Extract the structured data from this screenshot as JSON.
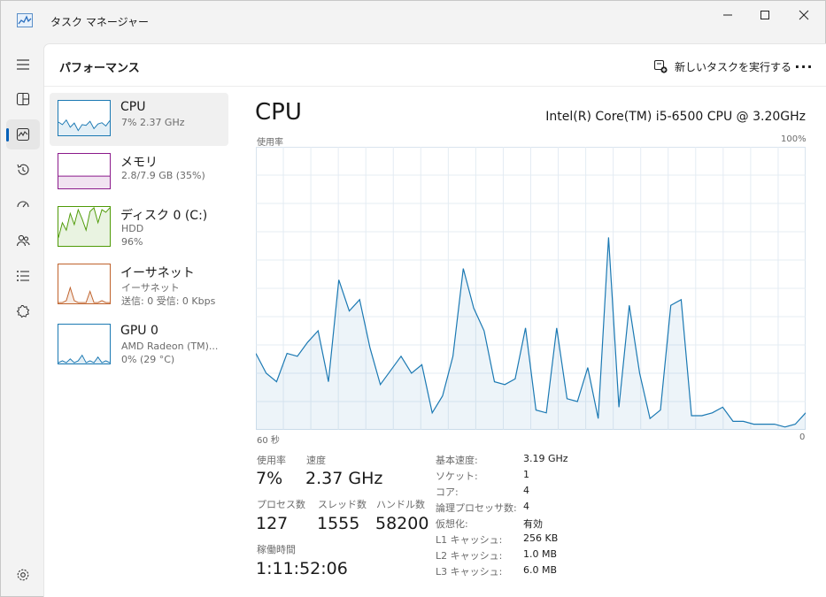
{
  "window": {
    "title": "タスク マネージャー"
  },
  "nav": {
    "items": [
      {
        "icon": "hamburger-menu-icon"
      },
      {
        "icon": "processes-icon"
      },
      {
        "icon": "performance-icon",
        "active": true
      },
      {
        "icon": "app-history-icon"
      },
      {
        "icon": "startup-apps-icon"
      },
      {
        "icon": "users-icon"
      },
      {
        "icon": "details-icon"
      },
      {
        "icon": "services-icon"
      },
      {
        "icon": "settings-icon"
      }
    ]
  },
  "header": {
    "page_title": "パフォーマンス",
    "new_task_label": "新しいタスクを実行する",
    "more_label": "···"
  },
  "devices": [
    {
      "name": "CPU",
      "sub1": "7%  2.37 GHz",
      "sub2": "",
      "sub3": "",
      "color": "#1b79b3",
      "spark": [
        38,
        30,
        44,
        22,
        35,
        12,
        30,
        28,
        40,
        18,
        32,
        36,
        26,
        42
      ]
    },
    {
      "name": "メモリ",
      "sub1": "2.8/7.9 GB (35%)",
      "sub2": "",
      "sub3": "",
      "color": "#8b1a8b",
      "spark": [
        35,
        35,
        35,
        35,
        35,
        35,
        35,
        35,
        35,
        35,
        35,
        35,
        35,
        35
      ]
    },
    {
      "name": "ディスク 0 (C:)",
      "sub1": "HDD",
      "sub2": "96%",
      "sub3": "",
      "color": "#4e9a06",
      "spark": [
        20,
        60,
        40,
        85,
        55,
        95,
        70,
        40,
        90,
        100,
        60,
        95,
        88,
        100
      ]
    },
    {
      "name": "イーサネット",
      "sub1": "イーサネット",
      "sub2": "送信: 0 受信: 0 Kbps",
      "sub3": "",
      "color": "#c0622b",
      "spark": [
        0,
        0,
        5,
        40,
        5,
        0,
        0,
        0,
        30,
        0,
        0,
        5,
        0,
        0
      ]
    },
    {
      "name": "GPU 0",
      "sub1": "AMD Radeon (TM)...",
      "sub2": "0%  (29 °C)",
      "sub3": "",
      "color": "#1b79b3",
      "spark": [
        0,
        5,
        0,
        10,
        0,
        5,
        20,
        0,
        5,
        0,
        15,
        0,
        5,
        0
      ]
    }
  ],
  "detail": {
    "title": "CPU",
    "model": "Intel(R) Core(TM) i5-6500 CPU @ 3.20GHz",
    "graph_label": "使用率",
    "graph_max": "100%",
    "time_left": "60 秒",
    "time_right": "0"
  },
  "stats": {
    "usage_label": "使用率",
    "usage_value": "7%",
    "speed_label": "速度",
    "speed_value": "2.37 GHz",
    "processes_label": "プロセス数",
    "processes_value": "127",
    "threads_label": "スレッド数",
    "threads_value": "1555",
    "handles_label": "ハンドル数",
    "handles_value": "58200",
    "uptime_label": "稼働時間",
    "uptime_value": "1:11:52:06"
  },
  "specs": [
    {
      "key": "基本速度:",
      "value": "3.19 GHz"
    },
    {
      "key": "ソケット:",
      "value": "1"
    },
    {
      "key": "コア:",
      "value": "4"
    },
    {
      "key": "論理プロセッサ数:",
      "value": "4"
    },
    {
      "key": "仮想化:",
      "value": "有効"
    },
    {
      "key": "L1 キャッシュ:",
      "value": "256 KB"
    },
    {
      "key": "L2 キャッシュ:",
      "value": "1.0 MB"
    },
    {
      "key": "L3 キャッシュ:",
      "value": "6.0 MB"
    }
  ],
  "chart_data": {
    "type": "area",
    "ylabel": "使用率",
    "ylim": [
      0,
      100
    ],
    "xlim": [
      60,
      0
    ],
    "xlabel_left": "60 秒",
    "xlabel_right": "0",
    "grid": true,
    "color": "#1b79b3",
    "series": [
      {
        "values": [
          27,
          20,
          17,
          27,
          26,
          31,
          35,
          17,
          53,
          42,
          46,
          29,
          16,
          21,
          26,
          20,
          23,
          6,
          12,
          26,
          57,
          43,
          35,
          17,
          16,
          18,
          36,
          7,
          6,
          36,
          11,
          10,
          22,
          4,
          68,
          8,
          44,
          20,
          4,
          7,
          44,
          46,
          5,
          5,
          6,
          8,
          3,
          3,
          2,
          2,
          2,
          1,
          2,
          6
        ]
      }
    ]
  }
}
